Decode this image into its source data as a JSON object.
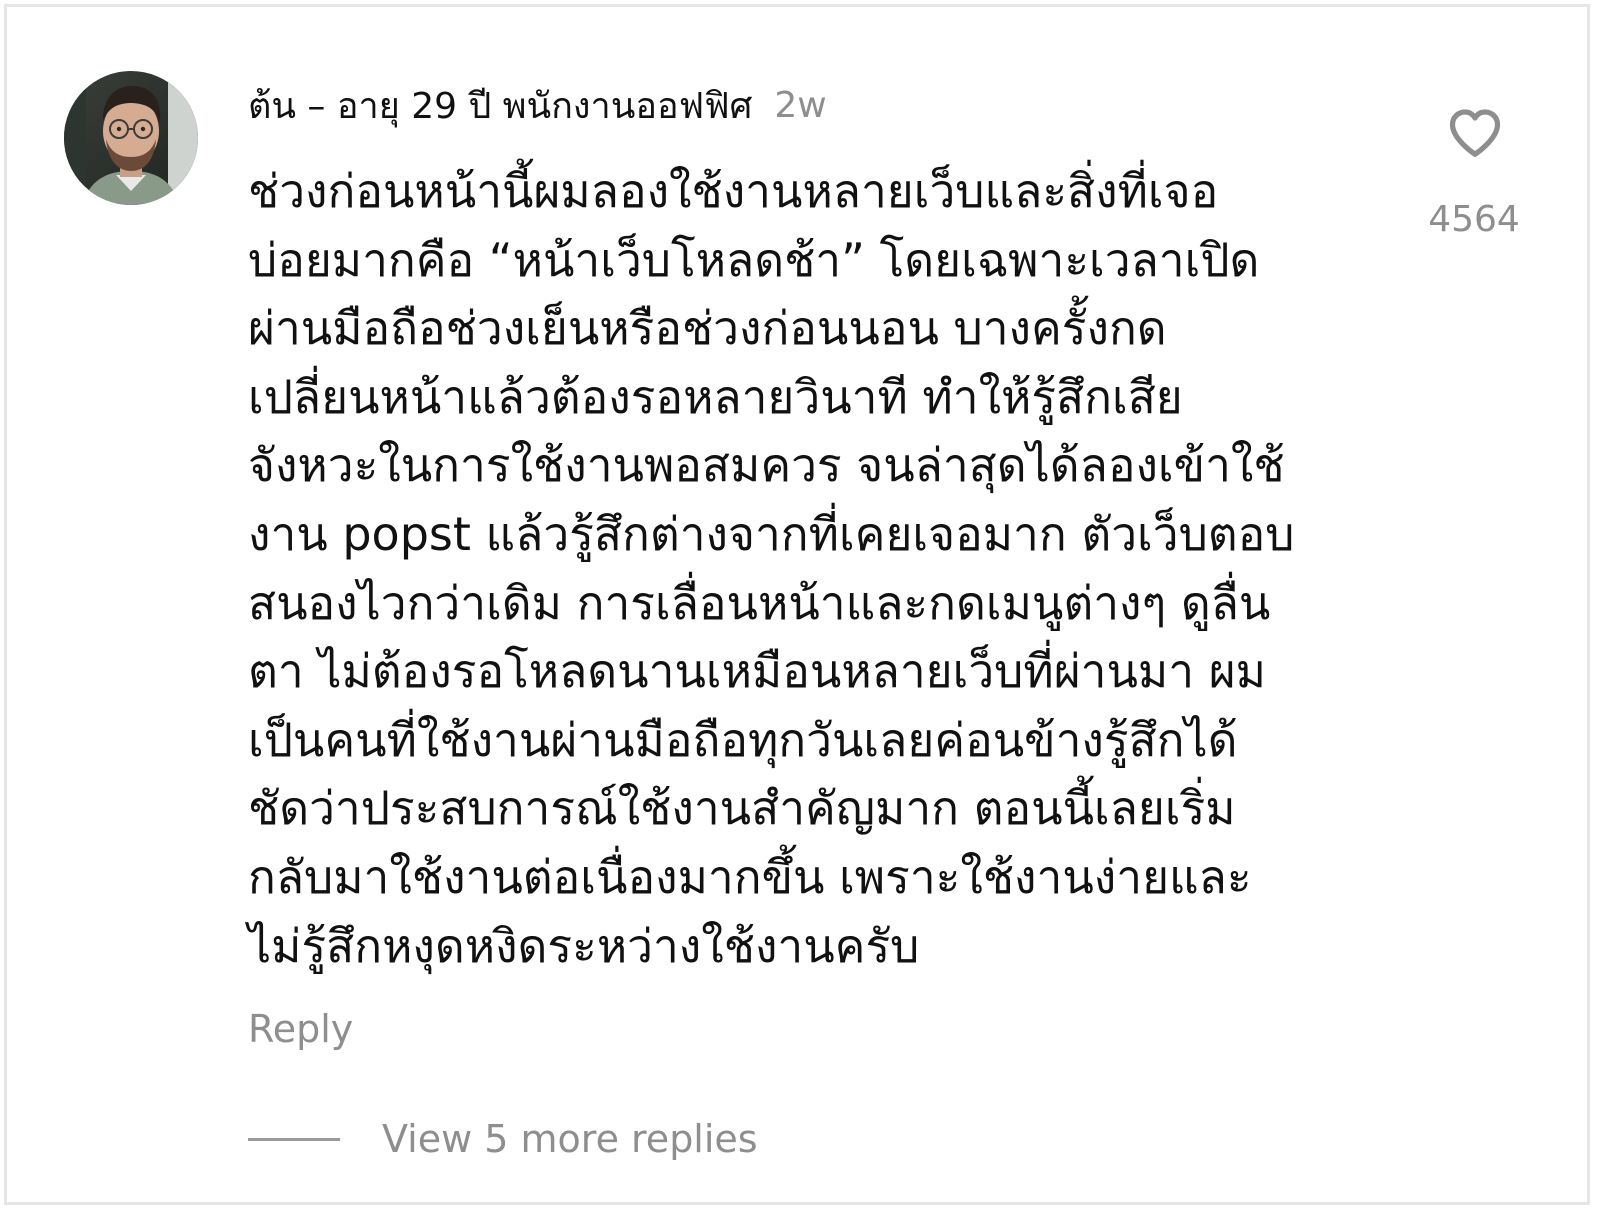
{
  "comment": {
    "username": "ต้น – อายุ 29 ปี พนักงานออฟฟิศ",
    "time_ago": "2w",
    "body_lines": [
      "ช่วงก่อนหน้านี้ผมลองใช้งานหลายเว็บและสิ่งที่เจอ",
      "บ่อยมากคือ “หน้าเว็บโหลดช้า” โดยเฉพาะเวลาเปิด",
      "ผ่านมือถือช่วงเย็นหรือช่วงก่อนนอน บางครั้งกด",
      "เปลี่ยนหน้าแล้วต้องรอหลายวินาที ทำให้รู้สึกเสีย",
      "จังหวะในการใช้งานพอสมควร จนล่าสุดได้ลองเข้าใช้",
      "งาน popst แล้วรู้สึกต่างจากที่เคยเจอมาก ตัวเว็บตอบ",
      "สนองไวกว่าเดิม การเลื่อนหน้าและกดเมนูต่างๆ ดูลื่น",
      "ตา ไม่ต้องรอโหลดนานเหมือนหลายเว็บที่ผ่านมา ผม",
      "เป็นคนที่ใช้งานผ่านมือถือทุกวันเลยค่อนข้างรู้สึกได้",
      "ชัดว่าประสบการณ์ใช้งานสำคัญมาก ตอนนี้เลยเริ่ม",
      "กลับมาใช้งานต่อเนื่องมากขึ้น เพราะใช้งานง่ายและ",
      "ไม่รู้สึกหงุดหงิดระหว่างใช้งานครับ"
    ],
    "like_count": "4564",
    "like_icon": "heart-outline-icon",
    "reply_label": "Reply",
    "view_replies_label": "View 5 more replies"
  },
  "colors": {
    "text_primary": "#111111",
    "text_secondary": "#8e8e8e",
    "icon": "#8e8e8e",
    "background": "#ffffff"
  }
}
